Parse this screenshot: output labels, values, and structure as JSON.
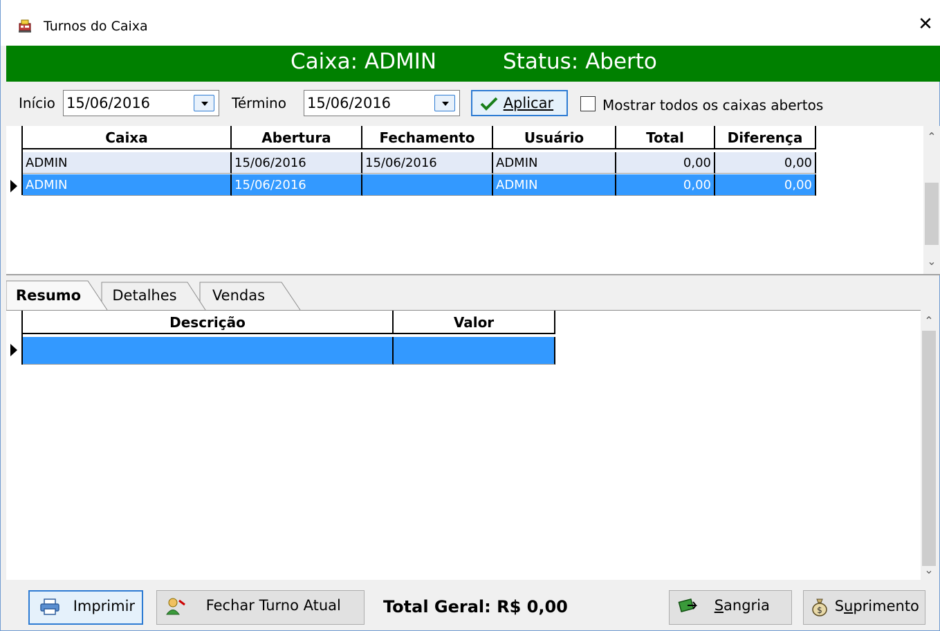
{
  "window": {
    "title": "Turnos do Caixa",
    "close_glyph": "✕",
    "app_icon": "cash-register-icon"
  },
  "banner": {
    "caixa": "Caixa: ADMIN",
    "status": "Status: Aberto",
    "color": "#008000"
  },
  "filter": {
    "inicio_label": "Início",
    "inicio_value": "15/06/2016",
    "termino_label": "Término",
    "termino_value": "15/06/2016",
    "apply_label": "Aplicar",
    "show_all_label": "Mostrar todos os caixas abertos",
    "show_all_checked": false
  },
  "shifts_grid": {
    "columns": [
      "Caixa",
      "Abertura",
      "Fechamento",
      "Usuário",
      "Total",
      "Diferença"
    ],
    "rows": [
      [
        "ADMIN",
        "15/06/2016",
        "15/06/2016",
        "ADMIN",
        "0,00",
        "0,00"
      ],
      [
        "ADMIN",
        "15/06/2016",
        "",
        "ADMIN",
        "0,00",
        "0,00"
      ]
    ],
    "selected_row": 1
  },
  "tabs": [
    {
      "label": "Resumo",
      "active": true
    },
    {
      "label": "Detalhes",
      "active": false
    },
    {
      "label": "Vendas",
      "active": false
    }
  ],
  "summary_grid": {
    "columns": [
      "Descrição",
      "Valor"
    ],
    "rows": [
      [
        "",
        ""
      ]
    ]
  },
  "footer": {
    "print_label": "Imprimir",
    "close_shift_label": "Fechar Turno Atual",
    "total_label": "Total Geral: R$ 0,00",
    "sangria_label": "angria",
    "sangria_underlined": "S",
    "suprimento_prefix": "S",
    "suprimento_underlined": "u",
    "suprimento_rest": "primento"
  },
  "colors": {
    "selection": "#3399ff",
    "alt_row": "#e3eaf7",
    "accent_border": "#2d7bd3"
  }
}
